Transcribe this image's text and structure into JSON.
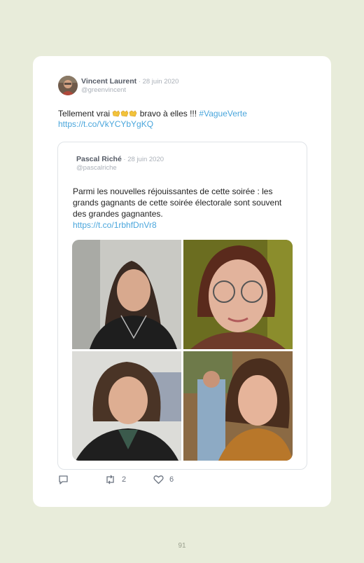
{
  "tweet": {
    "author_name": "Vincent Laurent",
    "date": " · 28 juin 2020",
    "handle": "@greenvincent",
    "text_before": "Tellement vrai ",
    "text_after": " bravo à elles !!! ",
    "hashtag": "#VagueVerte",
    "link": "https://t.co/VkYCYbYgKQ",
    "emoji_icon": "clapping-hands-icon"
  },
  "quoted": {
    "author_name": "Pascal Riché",
    "date": " · 28 juin 2020",
    "handle": "@pascalriche",
    "text": "Parmi les nouvelles réjouissantes de cette soirée : les grands gagnants de cette soirée électorale sont souvent des grandes gagnantes.",
    "link": "https://t.co/1rbhfDnVr8",
    "photos": [
      "photo-1",
      "photo-2",
      "photo-3",
      "photo-4"
    ]
  },
  "actions": {
    "reply_count": "",
    "retweet_count": "2",
    "like_count": "6"
  },
  "page": {
    "number": "91"
  }
}
